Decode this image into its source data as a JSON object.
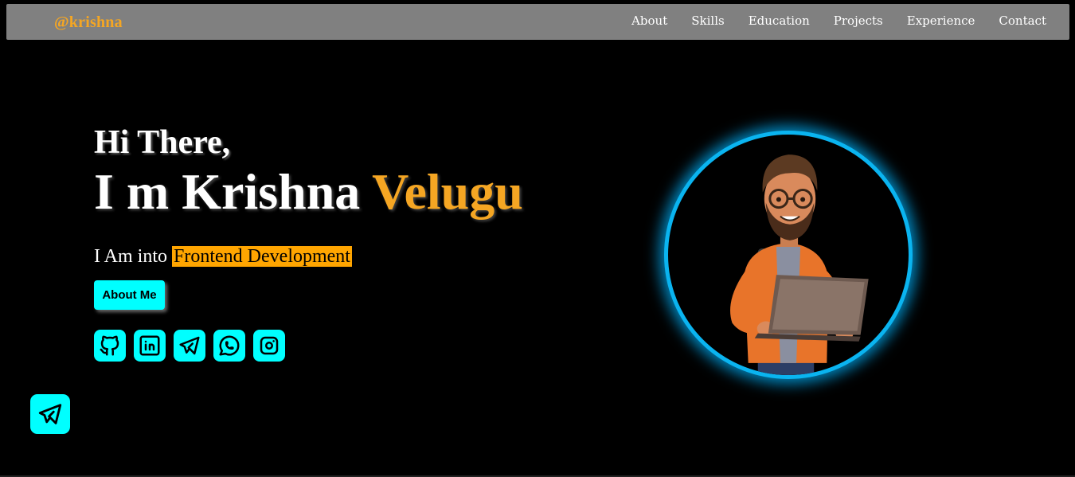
{
  "header": {
    "brand": "@krishna",
    "nav": [
      "About",
      "Skills",
      "Education",
      "Projects",
      "Experience",
      "Contact"
    ]
  },
  "hero": {
    "greeting": "Hi There,",
    "name_prefix": "I m Krishna",
    "name_accent": "Velugu",
    "role_prefix": "I Am into",
    "role_highlight": "Frontend Development",
    "about_button": "About Me"
  },
  "socials": [
    {
      "icon": "github-icon"
    },
    {
      "icon": "linkedin-icon"
    },
    {
      "icon": "telegram-icon"
    },
    {
      "icon": "whatsapp-icon"
    },
    {
      "icon": "instagram-icon"
    }
  ],
  "floating_button": {
    "icon": "telegram-icon"
  },
  "avatar": {
    "description_icon": "developer-avatar"
  },
  "colors": {
    "accent": "#f5a623",
    "cyan": "#00ffff",
    "ring": "#0ab4f0",
    "navbar": "#808080",
    "background": "#000000"
  }
}
